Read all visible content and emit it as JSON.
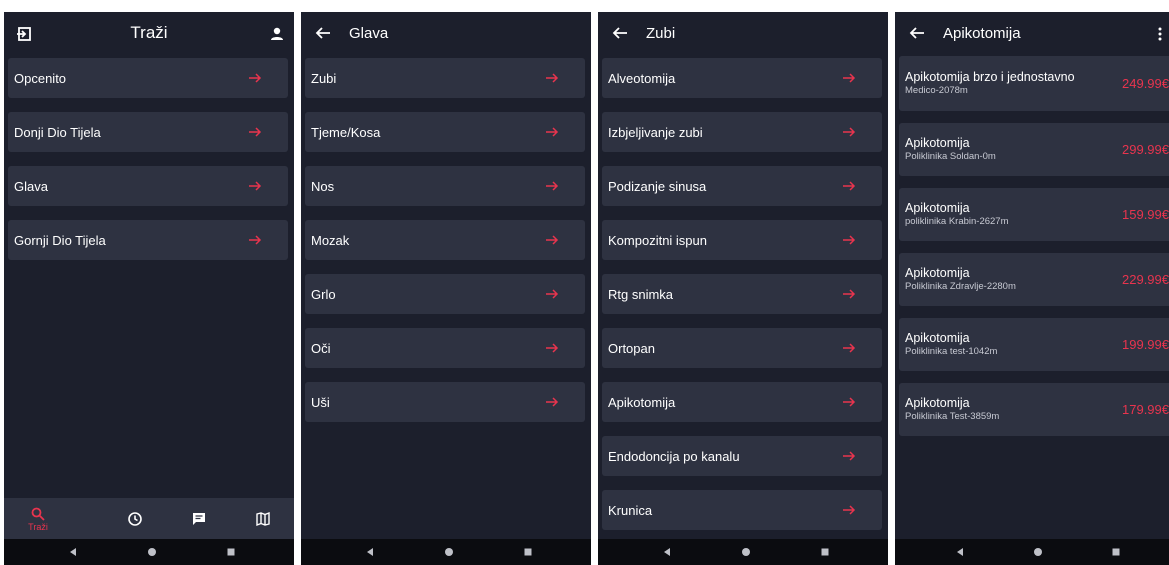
{
  "accent_color": "#e8344e",
  "screens": [
    {
      "title": "Traži",
      "left_icon": "login-icon",
      "right_icon": "person-icon",
      "items": [
        {
          "label": "Opcenito"
        },
        {
          "label": "Donji Dio Tijela"
        },
        {
          "label": "Glava"
        },
        {
          "label": "Gornji Dio Tijela"
        }
      ],
      "bottom_nav": [
        {
          "icon": "search-icon",
          "label": "Traži",
          "active": true
        },
        {
          "icon": "history-icon",
          "label": ""
        },
        {
          "icon": "message-icon",
          "label": ""
        },
        {
          "icon": "map-icon",
          "label": ""
        }
      ]
    },
    {
      "title": "Glava",
      "back_icon": "back-arrow-icon",
      "items": [
        {
          "label": "Zubi"
        },
        {
          "label": "Tjeme/Kosa"
        },
        {
          "label": "Nos"
        },
        {
          "label": "Mozak"
        },
        {
          "label": "Grlo"
        },
        {
          "label": "Oči"
        },
        {
          "label": "Uši"
        }
      ]
    },
    {
      "title": "Zubi",
      "back_icon": "back-arrow-icon",
      "items": [
        {
          "label": "Alveotomija"
        },
        {
          "label": "Izbjeljivanje zubi"
        },
        {
          "label": "Podizanje sinusa"
        },
        {
          "label": "Kompozitni ispun"
        },
        {
          "label": "Rtg snimka"
        },
        {
          "label": "Ortopan"
        },
        {
          "label": "Apikotomija"
        },
        {
          "label": "Endodoncija po kanalu"
        },
        {
          "label": "Krunica"
        }
      ]
    },
    {
      "title": "Apikotomija",
      "back_icon": "back-arrow-icon",
      "menu_icon": "more-vert-icon",
      "results": [
        {
          "name": "Apikotomija brzo i jednostavno",
          "clinic": "Medico-2078m",
          "price": "249.99€"
        },
        {
          "name": "Apikotomija",
          "clinic": "Poliklinika Soldan-0m",
          "price": "299.99€"
        },
        {
          "name": "Apikotomija",
          "clinic": "poliklinika Krabin-2627m",
          "price": "159.99€"
        },
        {
          "name": "Apikotomija",
          "clinic": "Poliklinika Zdravlje-2280m",
          "price": "229.99€"
        },
        {
          "name": "Apikotomija",
          "clinic": "Poliklinika test-1042m",
          "price": "199.99€"
        },
        {
          "name": "Apikotomija",
          "clinic": "Poliklinika Test-3859m",
          "price": "179.99€"
        }
      ]
    }
  ],
  "system_nav": [
    "back-triangle-icon",
    "home-circle-icon",
    "recents-square-icon"
  ]
}
